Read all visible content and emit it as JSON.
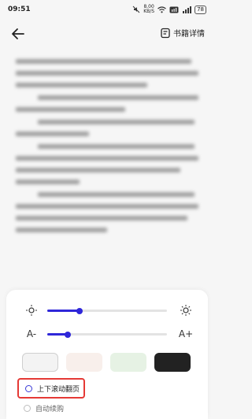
{
  "status_bar": {
    "time": "09:51",
    "network_speed": "8.00",
    "network_unit": "KB/S",
    "battery": "78"
  },
  "header": {
    "book_details_label": "书籍详情"
  },
  "settings_panel": {
    "brightness_level": 0.27,
    "font_size_level": 0.17,
    "font_decrease_label": "A-",
    "font_increase_label": "A+",
    "themes": [
      {
        "name": "white",
        "color": "#f3f3f3"
      },
      {
        "name": "pink",
        "color": "#f8efeb"
      },
      {
        "name": "green",
        "color": "#e6f2e4"
      },
      {
        "name": "black",
        "color": "#222222"
      }
    ],
    "scroll_mode_label": "上下滚动翻页",
    "auto_buy_label": "自动续购",
    "accent_color": "#2f27d9",
    "highlight_color": "#e53935"
  }
}
